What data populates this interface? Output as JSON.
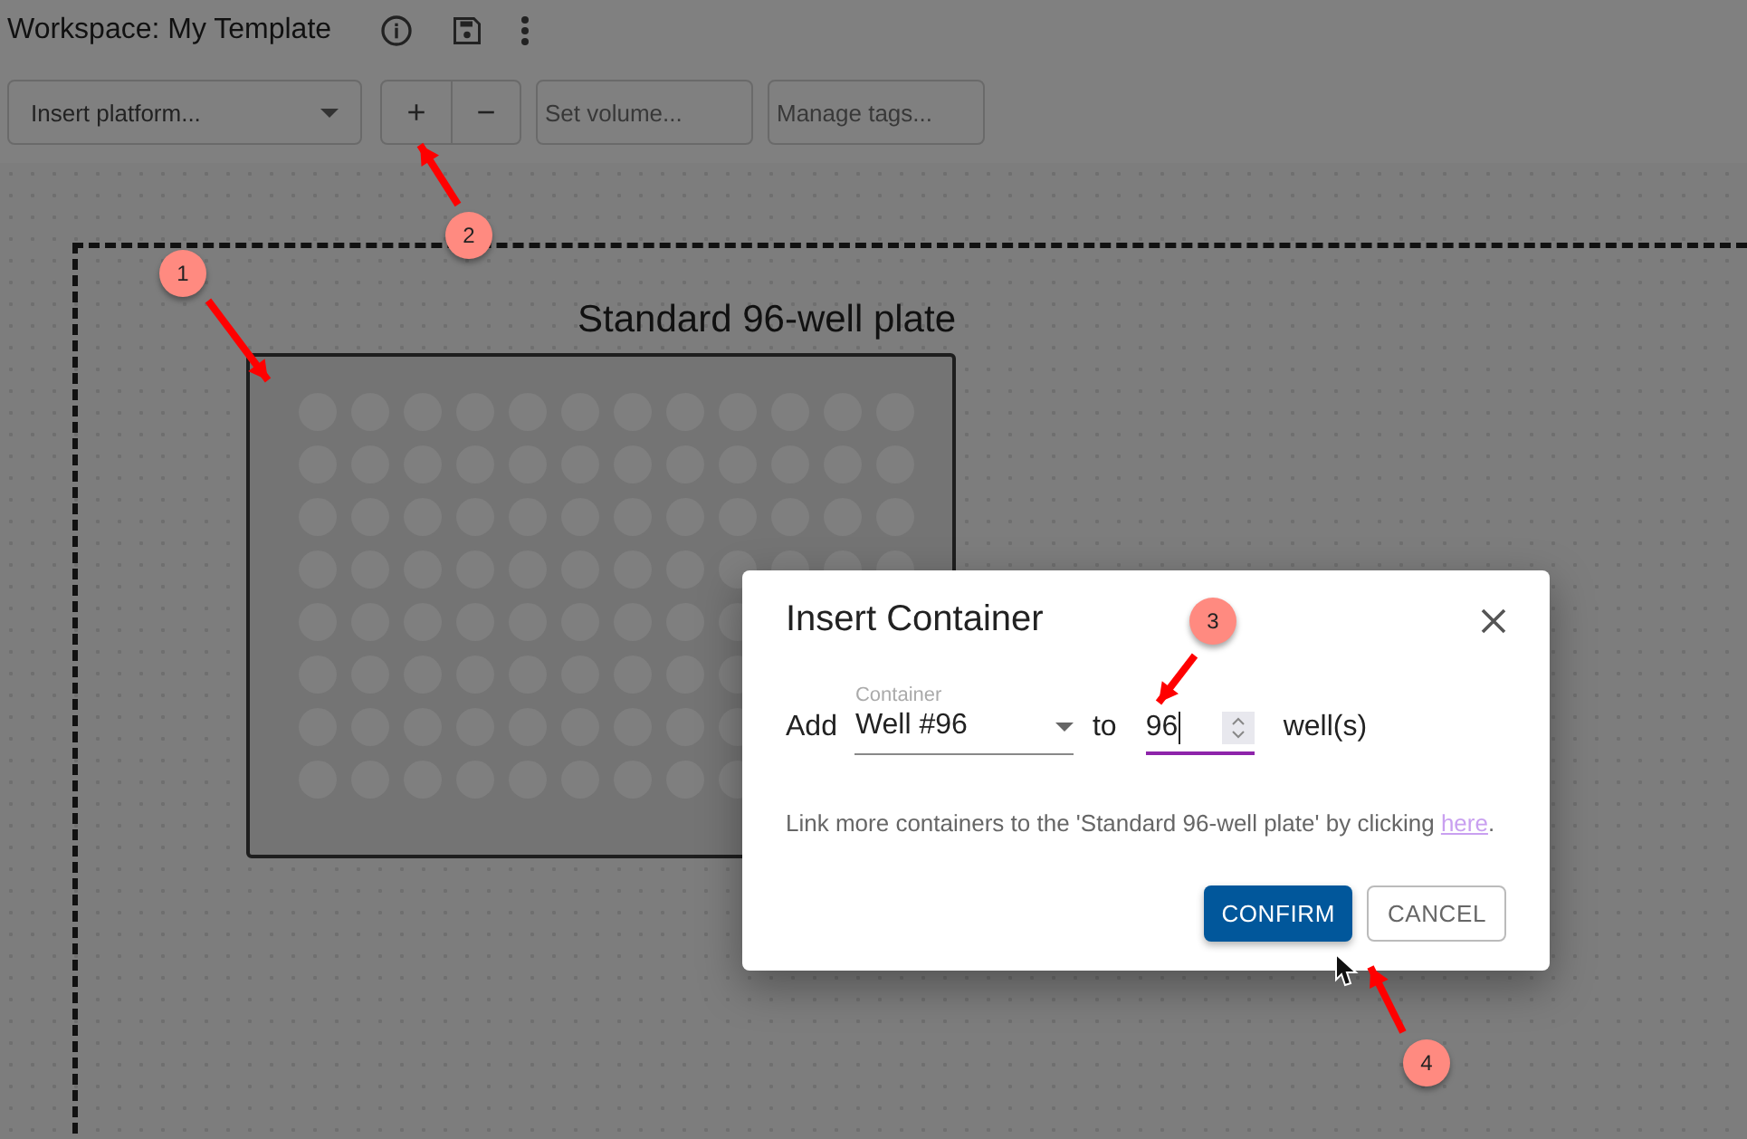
{
  "header": {
    "title": "Workspace: My Template"
  },
  "toolbar": {
    "platform_select": {
      "placeholder": "Insert platform..."
    },
    "add_button": {
      "label": "+"
    },
    "remove_button": {
      "label": "−"
    },
    "volume_field": {
      "placeholder": "Set volume..."
    },
    "tags_field": {
      "placeholder": "Manage tags..."
    }
  },
  "canvas": {
    "plate": {
      "title": "Standard 96-well plate"
    }
  },
  "dialog": {
    "title": "Insert Container",
    "prefix": "Add",
    "container_field": {
      "label": "Container",
      "value": "Well #96"
    },
    "connector": "to",
    "count_field": {
      "value": "96",
      "focused": true
    },
    "suffix": "well(s)",
    "note": "Link more containers to the 'Standard 96-well plate' by clicking ",
    "note_link": "here",
    "note_end": ".",
    "buttons": [
      {
        "label": "CONFIRM",
        "kind": "primary"
      },
      {
        "label": "CANCEL",
        "kind": "secondary"
      }
    ]
  },
  "annotations": [
    {
      "label": "1"
    },
    {
      "label": "2"
    },
    {
      "label": "3"
    },
    {
      "label": "4"
    }
  ]
}
